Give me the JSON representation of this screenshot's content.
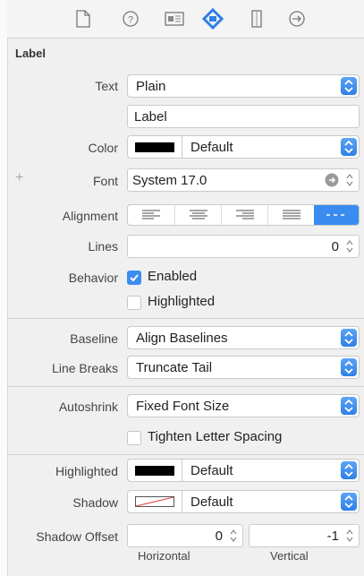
{
  "toolbar": {
    "icons": [
      "file-icon",
      "help-icon",
      "identity-icon",
      "attributes-icon",
      "size-icon",
      "connections-icon"
    ],
    "active_index": 3,
    "accent": "#2e7fe8"
  },
  "section": {
    "title": "Label"
  },
  "text_row": {
    "label": "Text",
    "value": "Plain",
    "field_value": "Label"
  },
  "color_row": {
    "label": "Color",
    "value": "Default",
    "swatch": "#000000"
  },
  "font_row": {
    "label": "Font",
    "value": "System 17.0"
  },
  "alignment_row": {
    "label": "Alignment",
    "options": [
      "left",
      "center",
      "right",
      "justified",
      "natural"
    ],
    "selected": "natural"
  },
  "lines_row": {
    "label": "Lines",
    "value": "0"
  },
  "behavior_row": {
    "label": "Behavior",
    "enabled": {
      "label": "Enabled",
      "checked": true
    },
    "highlighted": {
      "label": "Highlighted",
      "checked": false
    }
  },
  "baseline_row": {
    "label": "Baseline",
    "value": "Align Baselines"
  },
  "line_breaks_row": {
    "label": "Line Breaks",
    "value": "Truncate Tail"
  },
  "autoshrink_row": {
    "label": "Autoshrink",
    "value": "Fixed Font Size"
  },
  "tighten_row": {
    "label": "Tighten Letter Spacing",
    "checked": false
  },
  "highlighted_row": {
    "label": "Highlighted",
    "value": "Default",
    "swatch": "#000000"
  },
  "shadow_row": {
    "label": "Shadow",
    "value": "Default",
    "swatch": "none"
  },
  "shadow_offset_row": {
    "label": "Shadow Offset",
    "horizontal": {
      "value": "0",
      "label": "Horizontal"
    },
    "vertical": {
      "value": "-1",
      "label": "Vertical"
    }
  }
}
